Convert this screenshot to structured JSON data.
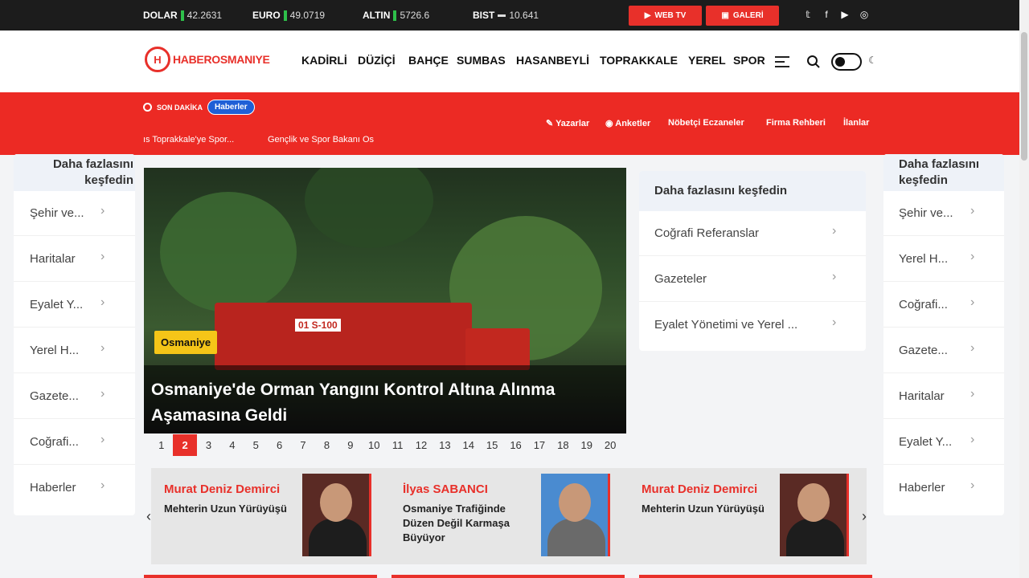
{
  "topbar": {
    "tickers": [
      {
        "label": "DOLAR",
        "value": "42.2631",
        "trend": "up"
      },
      {
        "label": "EURO",
        "value": "49.0719",
        "trend": "up"
      },
      {
        "label": "ALTIN",
        "value": "5726.6",
        "trend": "up"
      },
      {
        "label": "BIST",
        "value": "10.641",
        "trend": "flat"
      }
    ],
    "webtv_label": "WEB TV",
    "galeri_label": "GALERİ",
    "social_icons": [
      "twitter-icon",
      "facebook-icon",
      "youtube-icon",
      "instagram-icon"
    ]
  },
  "header": {
    "logo_text": "HABEROSMANIYE",
    "nav": [
      "KADİRLİ",
      "DÜZİÇİ",
      "BAHÇE",
      "SUMBAS",
      "HASANBEYLİ",
      "TOPRAKKALE",
      "YEREL",
      "SPOR"
    ]
  },
  "redband": {
    "son_dakika": "SON DAKİKA",
    "pill": "Haberler",
    "quick_links": [
      "Yazarlar",
      "Anketler",
      "Nöbetçi Eczaneler",
      "Firma Rehberi",
      "İlanlar"
    ],
    "marquee": [
      "ıs Toprakkale'ye Spor...",
      "Gençlik ve Spor Bakanı Os"
    ]
  },
  "left_card": {
    "title": "Daha fazlasını keşfedin",
    "items": [
      "Şehir ve...",
      "Haritalar",
      "Eyalet Y...",
      "Yerel H...",
      "Gazete...",
      "Coğrafi...",
      "Haberler"
    ]
  },
  "mid_card": {
    "title": "Daha fazlasını keşfedin",
    "items": [
      "Coğrafi Referanslar",
      "Gazeteler",
      "Eyalet Yönetimi ve Yerel ..."
    ]
  },
  "right_card": {
    "title": "Daha fazlasını keşfedin",
    "items": [
      "Şehir ve...",
      "Yerel H...",
      "Coğrafi...",
      "Gazete...",
      "Haritalar",
      "Eyalet Y...",
      "Haberler"
    ]
  },
  "hero": {
    "category": "Osmaniye",
    "title": "Osmaniye'de Orman Yangını Kontrol Altına Alınma Aşamasına Geldi",
    "truck_number": "01 S-100"
  },
  "pager": {
    "pages": [
      "1",
      "2",
      "3",
      "4",
      "5",
      "6",
      "7",
      "8",
      "9",
      "10",
      "11",
      "12",
      "13",
      "14",
      "15",
      "16",
      "17",
      "18",
      "19",
      "20"
    ],
    "active": "2"
  },
  "authors": [
    {
      "name": "Murat Deniz Demirci",
      "title": "Mehterin Uzun Yürüyüşü"
    },
    {
      "name": "İlyas SABANCI",
      "title": "Osmaniye Trafiğinde Düzen Değil Karmaşa Büyüyor"
    },
    {
      "name": "Murat Deniz Demirci",
      "title": "Mehterin Uzun Yürüyüşü"
    }
  ],
  "colors": {
    "brand_red": "#e8302a",
    "topbar": "#1c1c1c",
    "badge_yellow": "#f5c518",
    "pill_blue": "#1f5fd6"
  }
}
